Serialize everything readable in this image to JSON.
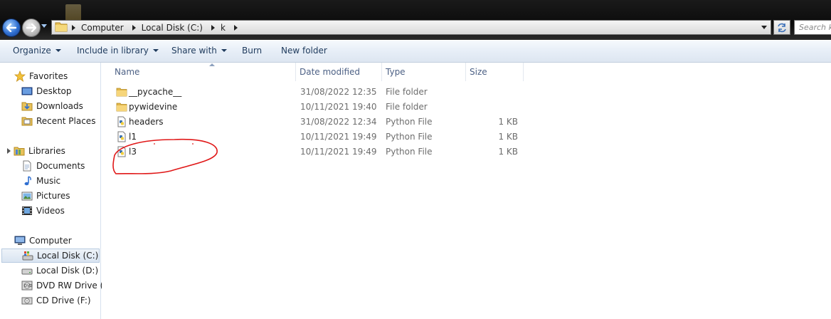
{
  "window": {
    "address": {
      "crumbs": [
        "Computer",
        "Local Disk (C:)",
        "k"
      ]
    },
    "search": {
      "placeholder": "Search k"
    }
  },
  "toolbar": {
    "organize": "Organize",
    "include_in_library": "Include in library",
    "share_with": "Share with",
    "burn": "Burn",
    "new_folder": "New folder"
  },
  "navpane": {
    "favorites": {
      "label": "Favorites",
      "items": [
        "Desktop",
        "Downloads",
        "Recent Places"
      ]
    },
    "libraries": {
      "label": "Libraries",
      "items": [
        "Documents",
        "Music",
        "Pictures",
        "Videos"
      ]
    },
    "computer": {
      "label": "Computer",
      "items": [
        "Local Disk (C:)",
        "Local Disk (D:)",
        "DVD RW Drive (E:",
        "CD Drive (F:)"
      ],
      "selected": "Local Disk (C:)"
    }
  },
  "columns": {
    "name": "Name",
    "date_modified": "Date modified",
    "type": "Type",
    "size": "Size"
  },
  "files": [
    {
      "name": "__pycache__",
      "date": "31/08/2022 12:35",
      "type": "File folder",
      "size": "",
      "icon": "folder-icon"
    },
    {
      "name": "pywidevine",
      "date": "10/11/2021 19:40",
      "type": "File folder",
      "size": "",
      "icon": "folder-icon"
    },
    {
      "name": "headers",
      "date": "31/08/2022 12:34",
      "type": "Python File",
      "size": "1 KB",
      "icon": "python-file-icon"
    },
    {
      "name": "l1",
      "date": "10/11/2021 19:49",
      "type": "Python File",
      "size": "1 KB",
      "icon": "python-file-icon"
    },
    {
      "name": "l3",
      "date": "10/11/2021 19:49",
      "type": "Python File",
      "size": "1 KB",
      "icon": "python-file-icon"
    }
  ],
  "colors": {
    "annotation": "#e01818",
    "header_text": "#4d6185",
    "toolbar_text": "#1e3a5c"
  }
}
